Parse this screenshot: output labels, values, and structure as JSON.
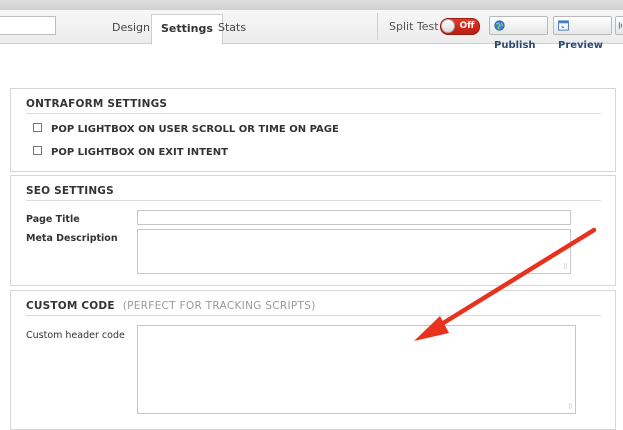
{
  "toolbar": {
    "tabs": [
      {
        "label": "Design"
      },
      {
        "label": "Settings"
      },
      {
        "label": "Stats"
      }
    ],
    "split_test_label": "Split Test",
    "toggle_state": "Off",
    "publish_label": "Publish",
    "preview_label": "Preview"
  },
  "ontraform": {
    "heading": "ONTRAFORM SETTINGS",
    "options": [
      {
        "label": "POP LIGHTBOX ON USER SCROLL OR TIME ON PAGE",
        "checked": false
      },
      {
        "label": "POP LIGHTBOX ON EXIT INTENT",
        "checked": false
      }
    ]
  },
  "seo": {
    "heading": "SEO SETTINGS",
    "page_title_label": "Page Title",
    "page_title_value": "",
    "meta_description_label": "Meta Description",
    "meta_description_value": ""
  },
  "custom_code": {
    "heading": "CUSTOM CODE",
    "subheading": "(PERFECT FOR TRACKING SCRIPTS)",
    "header_code_label": "Custom header code",
    "header_code_value": ""
  },
  "colors": {
    "toggle_off": "#d02d1f",
    "arrow": "#e8321e",
    "button_text": "#2c4a73"
  }
}
